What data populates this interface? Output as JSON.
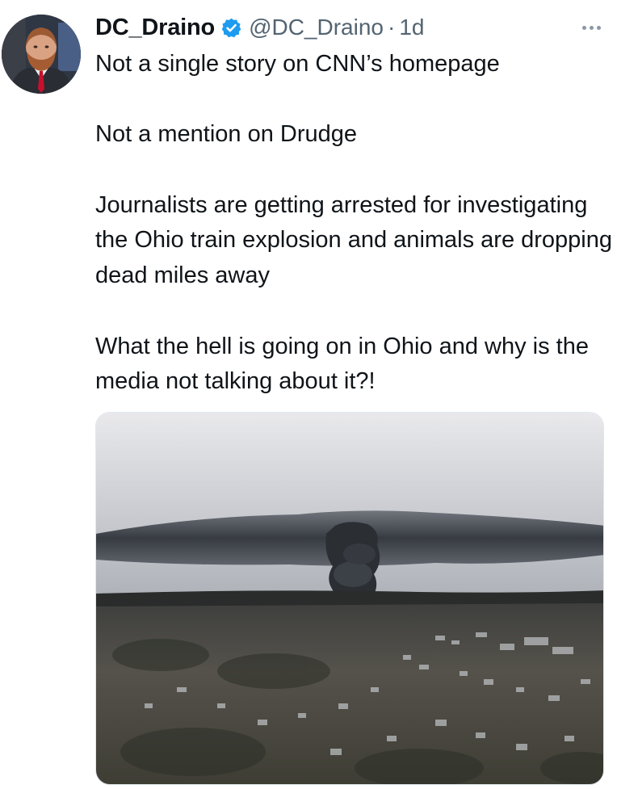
{
  "tweet": {
    "display_name": "DC_Draino",
    "verified": true,
    "handle": "@DC_Draino",
    "separator": "·",
    "time": "1d",
    "paragraphs": [
      "Not a single story on CNN’s homepage",
      "Not a mention on Drudge",
      "Journalists are getting arrested for investigating the Ohio train explosion and animals are dropping dead miles away",
      "What the hell is going on in Ohio and why is the media not talking about it?!"
    ],
    "icons": {
      "verified": "verified-badge-icon",
      "more": "more-options-icon"
    }
  },
  "colors": {
    "text": "#0f1419",
    "secondary": "#536471",
    "verified": "#1d9bf0"
  }
}
